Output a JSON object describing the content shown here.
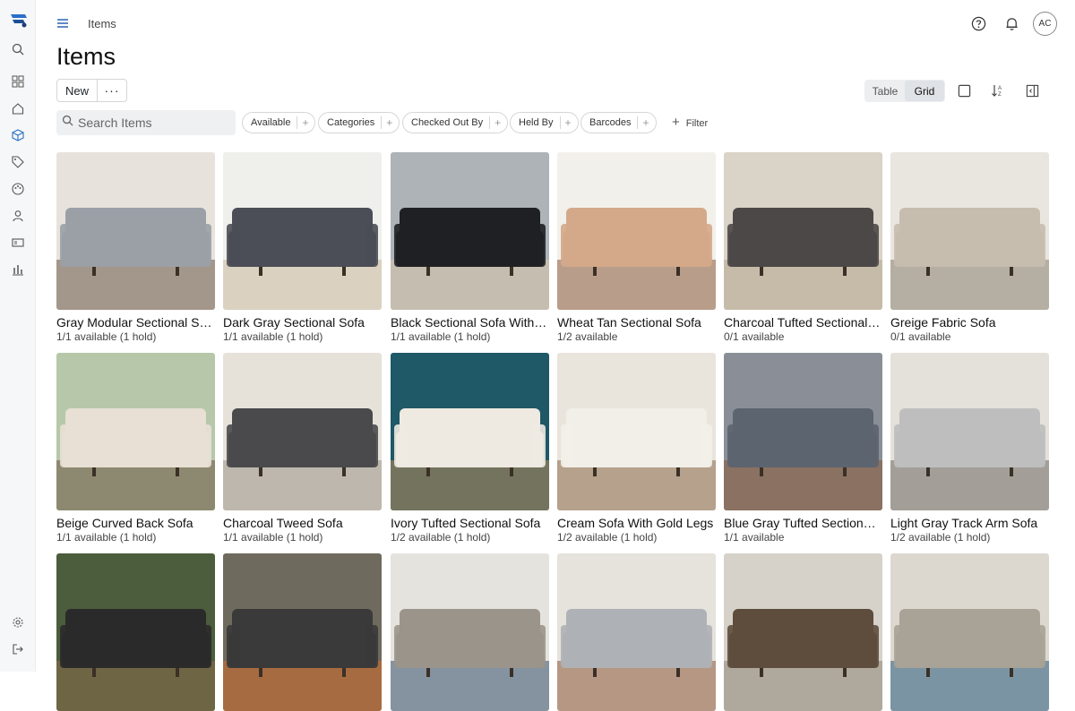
{
  "header": {
    "breadcrumb": "Items",
    "title": "Items",
    "avatar_initials": "AC"
  },
  "toolbar": {
    "new_label": "New",
    "more_label": "···",
    "views": [
      "Table",
      "Grid"
    ],
    "active_view": "Grid"
  },
  "search": {
    "placeholder": "Search Items"
  },
  "filters": [
    {
      "label": "Available"
    },
    {
      "label": "Categories"
    },
    {
      "label": "Checked Out By"
    },
    {
      "label": "Held By"
    },
    {
      "label": "Barcodes"
    }
  ],
  "add_filter_label": "Filter",
  "sidebar": {
    "items": [
      "search-icon",
      "dashboard-icon",
      "home-icon",
      "box-icon",
      "tag-icon",
      "palette-icon",
      "user-icon",
      "id-card-icon",
      "chart-icon"
    ],
    "bottom": [
      "gear-icon",
      "logout-icon"
    ]
  },
  "items": [
    {
      "name": "Gray Modular Sectional Sofa",
      "availability": "1/1 available (1 hold)",
      "colors": [
        "#e7e3dc",
        "#9aa0a6",
        "#6b5a48"
      ]
    },
    {
      "name": "Dark Gray Sectional Sofa",
      "availability": "1/1 available (1 hold)",
      "colors": [
        "#efefec",
        "#4b4e57",
        "#c8b89c"
      ]
    },
    {
      "name": "Black Sectional Sofa With Pillows",
      "availability": "1/1 available (1 hold)",
      "colors": [
        "#aeb3b8",
        "#1e2024",
        "#d8c7a9"
      ]
    },
    {
      "name": "Wheat Tan Sectional Sofa",
      "availability": "1/2 available",
      "colors": [
        "#f2f0ea",
        "#d4a98a",
        "#8b5a3c"
      ]
    },
    {
      "name": "Charcoal Tufted Sectional Sofa",
      "availability": "0/1 available",
      "colors": [
        "#d9d3c8",
        "#4c4847",
        "#b6a890"
      ]
    },
    {
      "name": "Greige Fabric Sofa",
      "availability": "0/1 available",
      "colors": [
        "#e9e6df",
        "#c6bdaf",
        "#8b7f70"
      ]
    },
    {
      "name": "Beige Curved Back Sofa",
      "availability": "1/1 available (1 hold)",
      "colors": [
        "#b6c8a9",
        "#e8e0d4",
        "#6b5642"
      ]
    },
    {
      "name": "Charcoal Tweed Sofa",
      "availability": "1/1 available (1 hold)",
      "colors": [
        "#e6e2da",
        "#4a4a4c",
        "#9d9488"
      ]
    },
    {
      "name": "Ivory Tufted Sectional Sofa",
      "availability": "1/2 available (1 hold)",
      "colors": [
        "#1f5866",
        "#eeeae2",
        "#b98a55"
      ]
    },
    {
      "name": "Cream Sofa With Gold Legs",
      "availability": "1/2 available (1 hold)",
      "colors": [
        "#e9e5dc",
        "#f2efe8",
        "#8a6a4a"
      ]
    },
    {
      "name": "Blue Gray Tufted Sectional Sofa",
      "availability": "1/1 available",
      "colors": [
        "#8a8f97",
        "#5c6470",
        "#8a5a36"
      ]
    },
    {
      "name": "Light Gray Track Arm Sofa",
      "availability": "1/2 available (1 hold)",
      "colors": [
        "#e4e1da",
        "#bebebe",
        "#6e6a63"
      ]
    },
    {
      "name": "",
      "availability": "",
      "colors": [
        "#4b5d3c",
        "#2b2a2a",
        "#8c6b4a"
      ]
    },
    {
      "name": "",
      "availability": "",
      "colors": [
        "#6f6a5e",
        "#3a3a3a",
        "#d56b2c"
      ]
    },
    {
      "name": "",
      "availability": "",
      "colors": [
        "#e4e3de",
        "#9b948a",
        "#37506e"
      ]
    },
    {
      "name": "",
      "availability": "",
      "colors": [
        "#e6e2dc",
        "#aeb1b5",
        "#8d5a3a"
      ]
    },
    {
      "name": "",
      "availability": "",
      "colors": [
        "#d6d2ca",
        "#5e4c3c",
        "#8f8578"
      ]
    },
    {
      "name": "",
      "availability": "",
      "colors": [
        "#dcd8d0",
        "#a9a296",
        "#2c5d7e"
      ]
    }
  ]
}
